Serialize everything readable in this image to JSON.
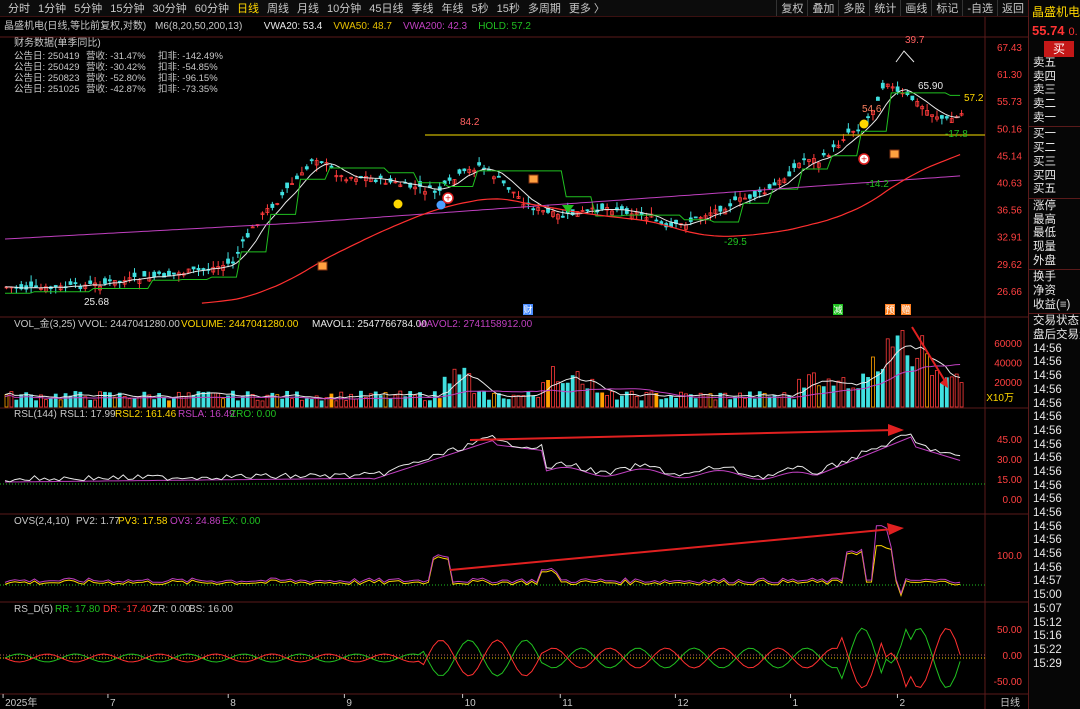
{
  "toolbar": {
    "periods": [
      "分时",
      "1分钟",
      "5分钟",
      "15分钟",
      "30分钟",
      "60分钟",
      "日线",
      "周线",
      "月线",
      "10分钟",
      "45日线",
      "季线",
      "年线",
      "5秒",
      "15秒",
      "多周期",
      "更多 〉"
    ],
    "active": "日线",
    "tools": [
      "复权",
      "叠加",
      "多股",
      "统计",
      "画线",
      "标记",
      "-自选",
      "返回"
    ]
  },
  "main_legend": {
    "title": "晶盛机电(日线,等比前复权,对数)",
    "items": [
      {
        "text": "M6(8,20,50,200,13)",
        "color": "#c8c8c8"
      },
      {
        "text": "VWA20: 53.4",
        "color": "#e8e8e8"
      },
      {
        "text": "VWA50: 48.7",
        "color": "#e8c000"
      },
      {
        "text": "VWA200: 42.3",
        "color": "#c040c0"
      },
      {
        "text": "HOLD: 57.2",
        "color": "#20c020"
      }
    ]
  },
  "finance": {
    "title": "财务数据(单季同比)",
    "rows": [
      [
        "公告日: 250419",
        "营收: -31.47%",
        "扣非: -142.49%"
      ],
      [
        "公告日: 250429",
        "营收: -30.42%",
        "扣非: -54.85%"
      ],
      [
        "公告日: 250823",
        "营收: -52.80%",
        "扣非: -96.15%"
      ],
      [
        "公告日: 251025",
        "营收: -42.87%",
        "扣非: -73.35%"
      ]
    ]
  },
  "price_axis": [
    "67.43",
    "61.30",
    "55.73",
    "50.16",
    "45.14",
    "40.63",
    "36.56",
    "32.91",
    "29.62",
    "26.66"
  ],
  "price_marks": {
    "high": "65.90",
    "top": "39.7",
    "peak1": "84.2",
    "mid": "54.6",
    "last": "57.2",
    "low1": "25.68",
    "low2": "-29.5",
    "low3": "-14.2",
    "low4": "-17.8"
  },
  "event_markers": [
    "财",
    "减",
    "预",
    "赠"
  ],
  "vol": {
    "name": "VOL_金(3,25)",
    "vvol": "VVOL: 2447041280.00",
    "volume": "VOLUME: 2447041280.00",
    "mavol1": "MAVOL1: 2547766784.00",
    "mavol2": "MAVOL2: 2741158912.00",
    "axis": [
      "60000",
      "40000",
      "20000"
    ],
    "unit": "X10万"
  },
  "rsl": {
    "name": "RSL(144)",
    "l1": "RSL1: 17.99",
    "l2": "RSL2: 161.46",
    "la": "RSLA: 16.49",
    "zro": "ZRO: 0.00",
    "axis": [
      "45.00",
      "30.00",
      "15.00",
      "0.00"
    ]
  },
  "ovs": {
    "name": "OVS(2,4,10)",
    "pv2": "PV2: 1.77",
    "pv3": "PV3: 17.58",
    "ov3": "OV3: 24.86",
    "ex": "EX: 0.00",
    "axis": [
      "100.0"
    ]
  },
  "rsd": {
    "name": "RS_D(5)",
    "rr": "RR: 17.80",
    "dr": "DR: -17.40",
    "zr": "ZR: 0.00",
    "bs": "BS: 16.00",
    "axis": [
      "50.00",
      "0.00",
      "-50.00"
    ]
  },
  "date_axis": [
    {
      "label": "2025年",
      "pos": 0.003
    },
    {
      "label": "7",
      "pos": 0.105
    },
    {
      "label": "8",
      "pos": 0.222
    },
    {
      "label": "9",
      "pos": 0.335
    },
    {
      "label": "10",
      "pos": 0.45
    },
    {
      "label": "11",
      "pos": 0.545
    },
    {
      "label": "12",
      "pos": 0.657
    },
    {
      "label": "1",
      "pos": 0.769
    },
    {
      "label": "2",
      "pos": 0.873
    }
  ],
  "day_label": "日线",
  "sidebar": {
    "stock": "晶盛机电",
    "price": "55.74",
    "price_extra": "0.",
    "buy": "买",
    "rows": [
      "卖五",
      "卖四",
      "卖三",
      "卖二",
      "卖一",
      "买一",
      "买二",
      "买三",
      "买四",
      "买五",
      "涨停",
      "最高",
      "最低",
      "现量",
      "外盘",
      "换手",
      "净资",
      "收益(≡)",
      "交易状态:",
      "盘后交易量",
      "14:56",
      "14:56",
      "14:56",
      "14:56",
      "14:56",
      "14:56",
      "14:56",
      "14:56",
      "14:56",
      "14:56",
      "14:56",
      "14:56",
      "14:56",
      "14:56",
      "14:56",
      "14:56",
      "14:56",
      "14:57",
      "15:00",
      "15:07",
      "15:12",
      "15:16",
      "15:22",
      "15:29"
    ]
  },
  "colors": {
    "up": "#ff3b3b",
    "down": "#40e0e0",
    "ma20": "#e8e8e8",
    "hold": "#20c020",
    "ma200": "#c040c0",
    "hline": "#c8b400",
    "arrow": "#e02020",
    "accent": "#ffd700"
  }
}
